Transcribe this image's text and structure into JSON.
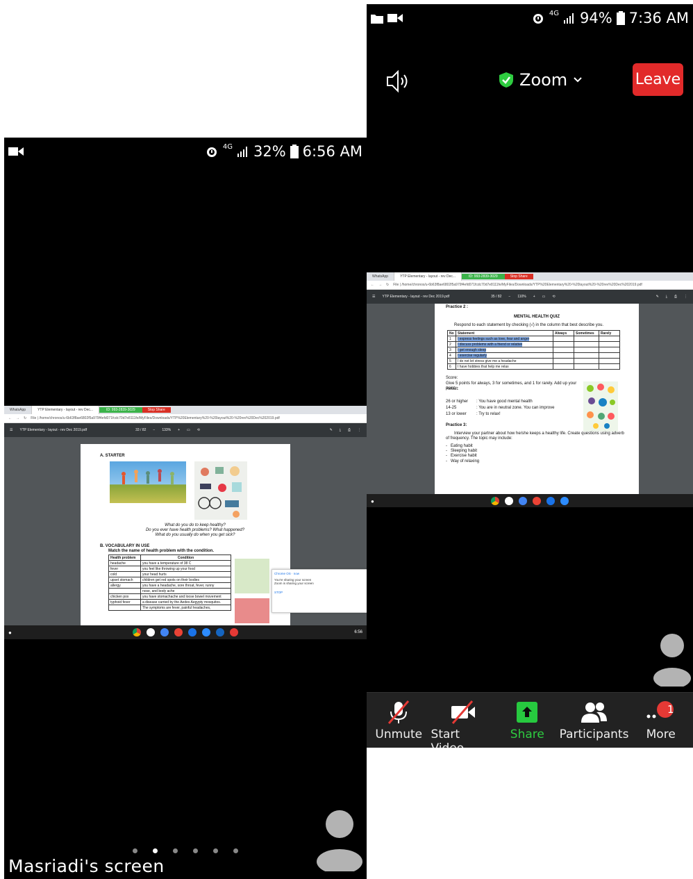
{
  "left_phone": {
    "status": {
      "signal": "4G",
      "battery": "32%",
      "time": "6:56 AM"
    },
    "shared_screen": {
      "tabs": [
        "WhatsApp",
        "YTP Elementary - layout - rev Dec..."
      ],
      "meeting_id": "ID: 993-2839-3029",
      "stop_share": "Stop Share",
      "url": "File | /home/chronos/u-6b63f8ae6802f5a979f4efd071fcdc70d7e8111fe/MyFiles/Downloads/YTP%20Elementary%20-%20layout%20-%20rev%20Dec%202019.pdf",
      "pdf_title": "YTP Elementary - layout - rev Dec 2019.pdf",
      "page_info": "33 / 82",
      "zoom": "133%",
      "section_a": "A.  STARTER",
      "questions": [
        "What do you do to keep healthy?",
        "Do you ever have health problems? What happened?",
        "What do you usually do when you get sick?"
      ],
      "section_b": "B.  VOCABULARY IN USE",
      "instruction": "Match the name of health problem with the condition.",
      "table_headers": [
        "Health problem",
        "Condition"
      ],
      "table_rows": [
        [
          "headache",
          "you have a temperature of 38 C"
        ],
        [
          "fever",
          "you feel like throwing up your food"
        ],
        [
          "cold",
          "your head hurts"
        ],
        [
          "upset stomach",
          "children get red spots on their bodies"
        ],
        [
          "allergy",
          "you have a headache, sore throat, fever, runny"
        ],
        [
          "",
          "nose, and body ache"
        ],
        [
          "chicken pox",
          "you have stomachache and loose bowel movement"
        ],
        [
          "typhoid fever",
          "a disease carried by the Aedes Aegypty mosquitos."
        ],
        [
          "",
          "The symptoms are fever, painful headaches,"
        ]
      ],
      "popup": {
        "title": "Chrome OS · now",
        "line1": "You're sharing your screen",
        "line2": "Zoom is sharing your screen",
        "action": "STOP"
      },
      "tray_time": "6:56"
    },
    "caption": "Masriadi's screen"
  },
  "right_phone": {
    "status": {
      "signal": "4G",
      "battery": "94%",
      "time": "7:36 AM"
    },
    "title": "Zoom",
    "leave_label": "Leave",
    "shared_screen": {
      "tabs": [
        "WhatsApp",
        "YTP Elementary - layout - rev Dec..."
      ],
      "meeting_id": "ID: 993-2839-3029",
      "stop_share": "Stop Share",
      "url": "File | /home/chronos/u-6b63f8ae6802f5a979f4efd071fcdc70d7e8111fe/MyFiles/Downloads/YTP%20Elementary%20-%20layout%20-%20rev%20Dec%202019.pdf",
      "pdf_title": "YTP Elementary - layout - rev Dec 2019.pdf",
      "page_info": "35 / 82",
      "zoom": "110%",
      "practice2": "Practice 2 :",
      "quiz_title": "MENTAL HEALTH QUIZ",
      "quiz_instruction": "Respond to each statement by checking (√) in the column that best describe you.",
      "quiz_headers": [
        "No",
        "Statement",
        "Always",
        "Sometimes",
        "Rarely"
      ],
      "quiz_rows": [
        [
          "1",
          "I express feelings such as love, fear and anger"
        ],
        [
          "2",
          "I discuss problems with a friend or relative"
        ],
        [
          "3",
          "I get enough sleep"
        ],
        [
          "4",
          "I exercise regularly"
        ],
        [
          "5",
          "I do not let stress give me a headache"
        ],
        [
          "6",
          "I have hobbies that help me relax"
        ]
      ],
      "score_label": "Score:",
      "score_text": "Give 5 points for always, 3 for sometimes, and 1 for rarely. Add up your point",
      "result_label": "Result:",
      "results": [
        [
          "26 or higher",
          ": You have good mental health"
        ],
        [
          "14-25",
          ": You are in neutral zone. You can improve"
        ],
        [
          "13 or lower",
          ": Try to relax!"
        ]
      ],
      "practice3": "Practice 3:",
      "practice3_text": "Interview your partner about how he/she keeps a healthy life. Create questions using adverb of frequency. The topic may include:",
      "topics": [
        "Eating habit",
        "Sleeping habit",
        "Exercise habit",
        "Way of relaxing"
      ]
    },
    "controls": [
      {
        "label": "Unmute",
        "icon": "mic-muted-icon"
      },
      {
        "label": "Start Video",
        "icon": "video-off-icon"
      },
      {
        "label": "Share",
        "icon": "share-icon"
      },
      {
        "label": "Participants",
        "icon": "participants-icon"
      },
      {
        "label": "More",
        "icon": "more-icon",
        "badge": "1"
      }
    ]
  }
}
